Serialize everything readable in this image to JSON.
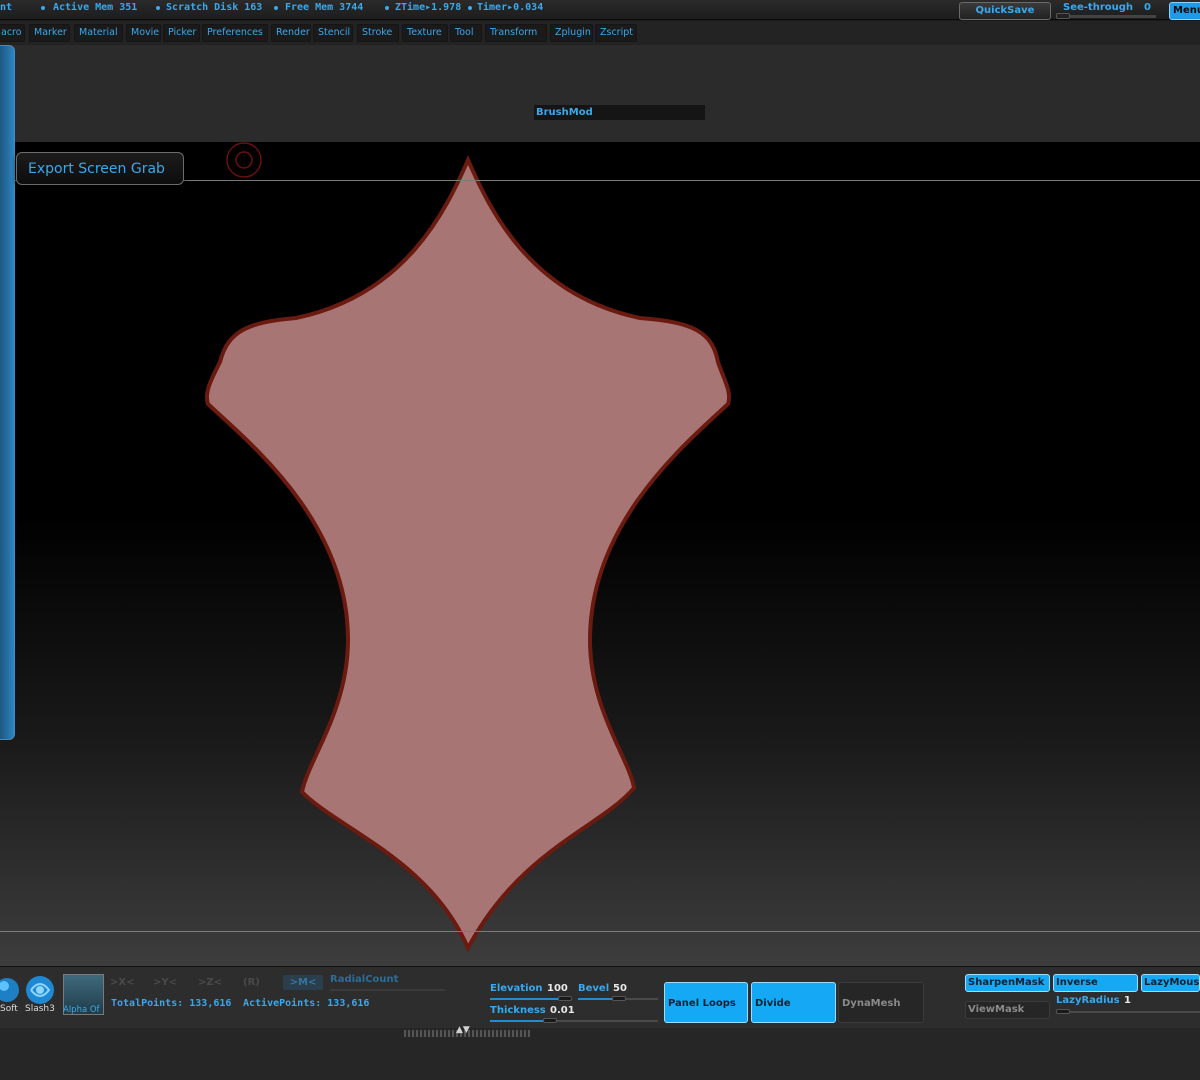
{
  "status": {
    "partial_label": "nt",
    "active_mem": "Active Mem 351",
    "scratch_disk": "Scratch Disk 163",
    "free_mem": "Free Mem 3744",
    "ztime": "ZTime▸1.978",
    "timer": "Timer▸0.034",
    "quicksave": "QuickSave",
    "see_through_label": "See-through",
    "see_through_value": "0",
    "see_through_level": 0,
    "menus": "Menus"
  },
  "menu": {
    "items": [
      "acro",
      "Marker",
      "Material",
      "Movie",
      "Picker",
      "Preferences",
      "Render",
      "Stencil",
      "Stroke",
      "Texture",
      "Tool",
      "Transform",
      "Zplugin",
      "Zscript"
    ]
  },
  "shelf": {
    "brushmod": "BrushMod"
  },
  "canvas": {
    "export_button": "Export Screen Grab",
    "cursor_icon": "brush-cursor-icon",
    "shape_fill": "#a87575",
    "shape_stroke": "#6b1a10"
  },
  "bottom": {
    "brush1_label": "Soft",
    "brush2_label": "Slash3",
    "alpha_label": "Alpha Of",
    "sym_x": ">X<",
    "sym_y": ">Y<",
    "sym_z": ">Z<",
    "sym_r": "(R)",
    "sym_m": ">M<",
    "radial_count": "RadialCount",
    "total_points": "TotalPoints: 133,616",
    "active_points": "ActivePoints: 133,616",
    "elevation_label": "Elevation",
    "elevation_value": "100",
    "bevel_label": "Bevel",
    "bevel_value": "50",
    "thickness_label": "Thickness",
    "thickness_value": "0.01",
    "panel_loops": "Panel Loops",
    "divide": "Divide",
    "dynamesh": "DynaMesh",
    "sharpen_mask": "SharpenMask",
    "inverse": "Inverse",
    "lazy_mouse": "LazyMouse",
    "view_mask": "ViewMask",
    "lazy_radius_label": "LazyRadius",
    "lazy_radius_value": "1"
  },
  "colors": {
    "accent": "#3aa8ec",
    "button_on": "#15a8f5"
  }
}
